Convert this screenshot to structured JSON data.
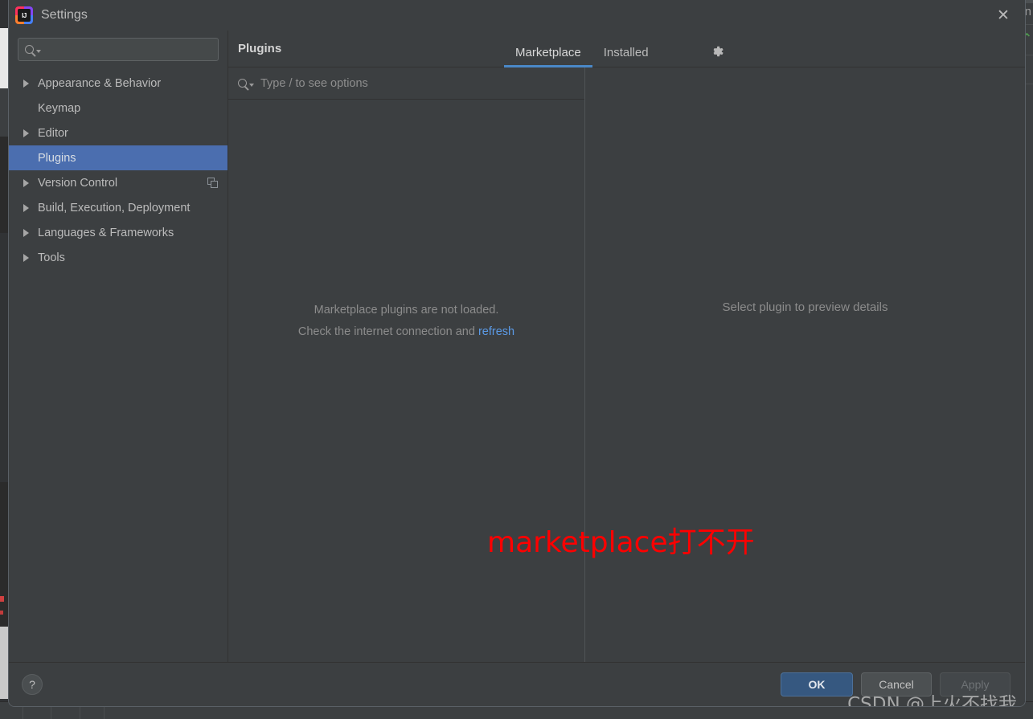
{
  "window": {
    "title": "Settings",
    "logo_icon": "intellij-idea-icon",
    "close_icon": "close-icon"
  },
  "sidebar": {
    "search": {
      "placeholder": "",
      "value": "",
      "icon": "search-icon"
    },
    "items": [
      {
        "label": "Appearance & Behavior",
        "expandable": true,
        "selected": false,
        "badge": null
      },
      {
        "label": "Keymap",
        "expandable": false,
        "selected": false,
        "badge": null
      },
      {
        "label": "Editor",
        "expandable": true,
        "selected": false,
        "badge": null
      },
      {
        "label": "Plugins",
        "expandable": false,
        "selected": true,
        "badge": null
      },
      {
        "label": "Version Control",
        "expandable": true,
        "selected": false,
        "badge": "copy-icon"
      },
      {
        "label": "Build, Execution, Deployment",
        "expandable": true,
        "selected": false,
        "badge": null
      },
      {
        "label": "Languages & Frameworks",
        "expandable": true,
        "selected": false,
        "badge": null
      },
      {
        "label": "Tools",
        "expandable": true,
        "selected": false,
        "badge": null
      }
    ]
  },
  "content": {
    "page_title": "Plugins",
    "tabs": [
      {
        "label": "Marketplace",
        "active": true
      },
      {
        "label": "Installed",
        "active": false
      }
    ],
    "gear_icon": "gear-icon",
    "plugin_search": {
      "placeholder": "Type / to see options",
      "value": "",
      "icon": "search-icon"
    },
    "empty_state": {
      "line1": "Marketplace plugins are not loaded.",
      "line2_prefix": "Check the internet connection and ",
      "link": "refresh"
    },
    "preview": {
      "text": "Select plugin to preview details"
    }
  },
  "annotation": {
    "text": "marketplace打不开",
    "color": "#fe0000"
  },
  "footer": {
    "help_label": "?",
    "buttons": [
      {
        "label": "OK",
        "style": "primary",
        "enabled": true
      },
      {
        "label": "Cancel",
        "style": "default",
        "enabled": true
      },
      {
        "label": "Apply",
        "style": "disabled",
        "enabled": false
      }
    ]
  },
  "watermark": {
    "text": "CSDN @上火不找我"
  },
  "background": {
    "right_glyph": "n",
    "right_chevron": "⌃"
  },
  "colors": {
    "dialog_bg": "#3c3f41",
    "selection_blue": "#4b6eaf",
    "tab_underline": "#4a88c7",
    "link_blue": "#5b9ae6",
    "primary_button": "#365880",
    "annotation_red": "#fe0000"
  }
}
